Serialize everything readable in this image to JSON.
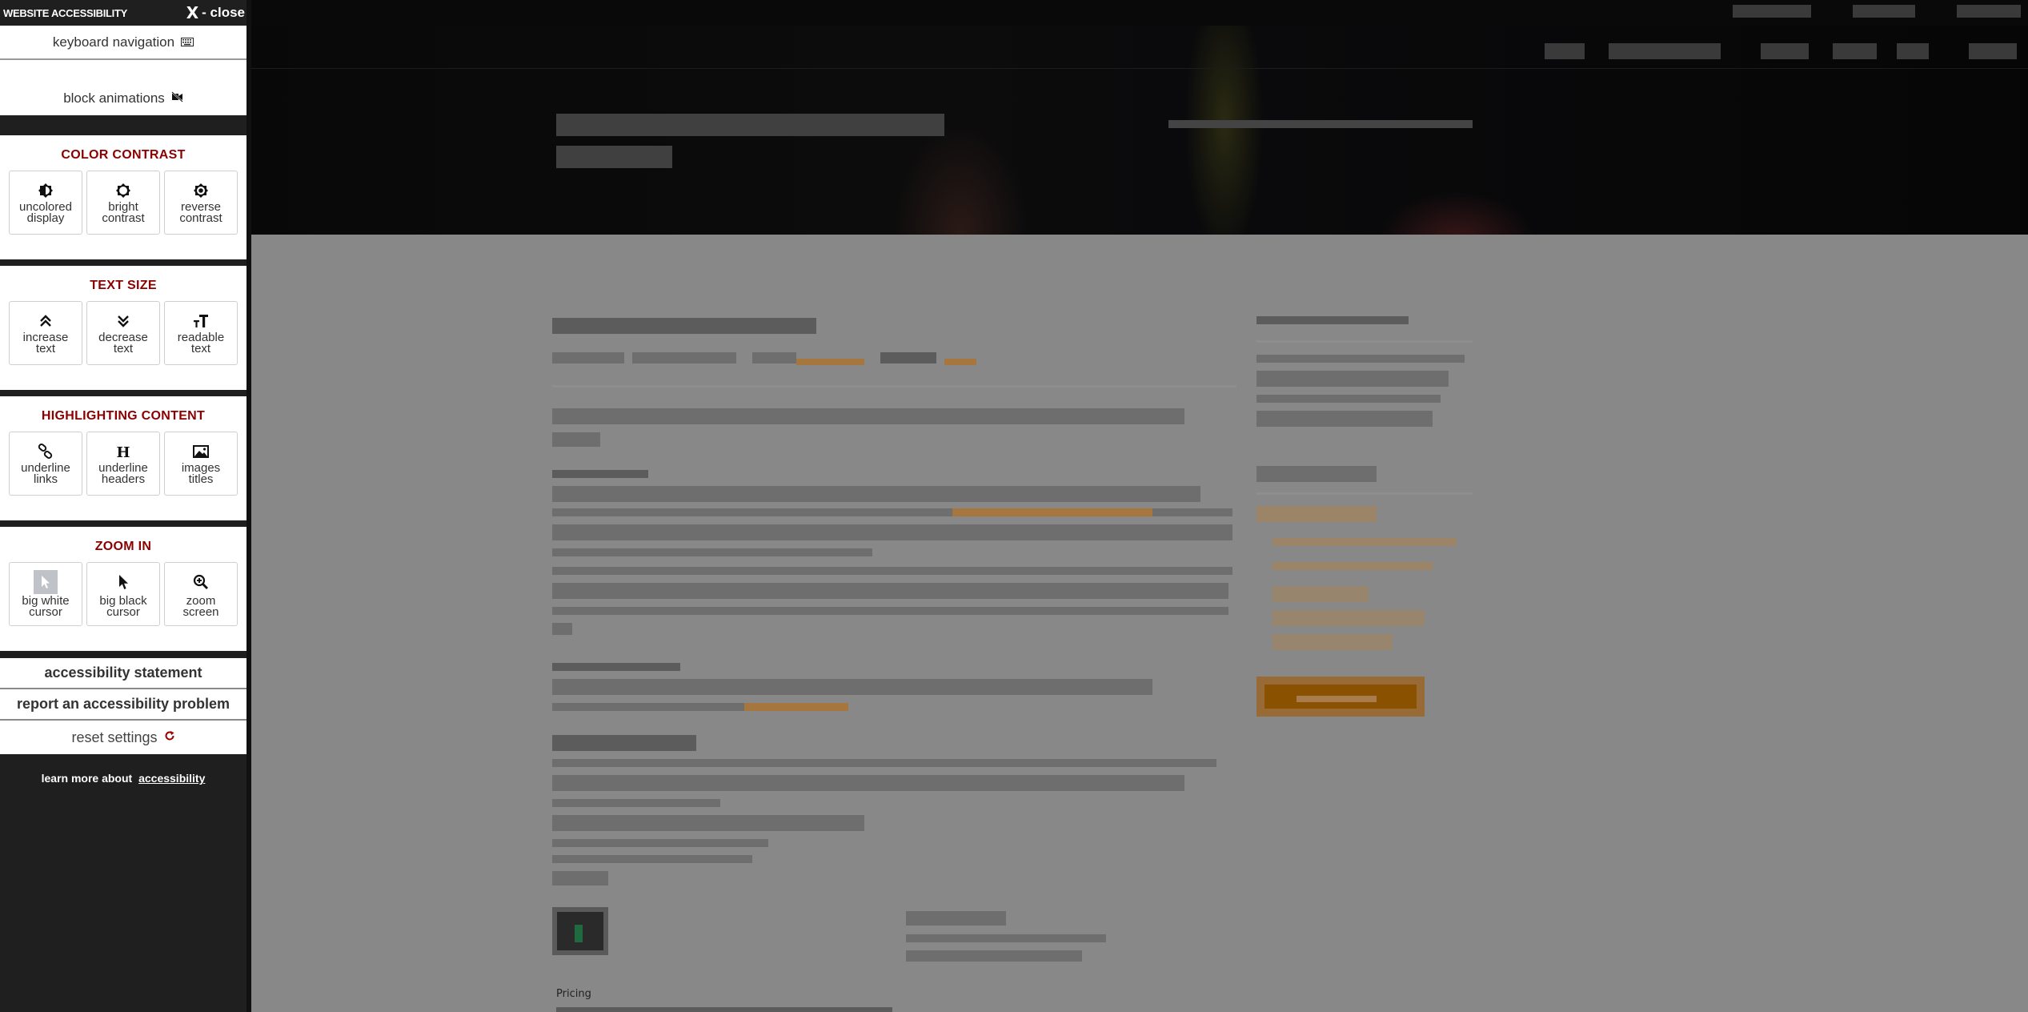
{
  "panel": {
    "title": "WEBSITE ACCESSIBILITY",
    "close_label": "X - close",
    "close_x": "X",
    "close_text": "- close",
    "keyboard_navigation": {
      "label": "keyboard navigation",
      "icon": "keyboard-icon"
    },
    "block_animations": {
      "label": "block animations",
      "icon": "video-off-icon"
    },
    "sections": [
      {
        "title": "COLOR CONTRAST",
        "options": [
          {
            "line1": "uncolored",
            "line2": "display",
            "icon": "half-contrast-icon"
          },
          {
            "line1": "bright",
            "line2": "contrast",
            "icon": "brightness-icon"
          },
          {
            "line1": "reverse",
            "line2": "contrast",
            "icon": "reverse-contrast-icon"
          }
        ]
      },
      {
        "title": "TEXT SIZE",
        "options": [
          {
            "line1": "increase",
            "line2": "text",
            "icon": "double-chevron-up-icon"
          },
          {
            "line1": "decrease",
            "line2": "text",
            "icon": "double-chevron-down-icon"
          },
          {
            "line1": "readable",
            "line2": "text",
            "icon": "text-size-icon"
          }
        ]
      },
      {
        "title": "HIGHLIGHTING CONTENT",
        "options": [
          {
            "line1": "underline",
            "line2": "links",
            "icon": "link-icon"
          },
          {
            "line1": "underline",
            "line2": "headers",
            "icon": "header-icon"
          },
          {
            "line1": "images",
            "line2": "titles",
            "icon": "image-icon"
          }
        ]
      },
      {
        "title": "ZOOM IN",
        "options": [
          {
            "line1": "big white",
            "line2": "cursor",
            "icon": "white-cursor-icon"
          },
          {
            "line1": "big black",
            "line2": "cursor",
            "icon": "black-cursor-icon"
          },
          {
            "line1": "zoom",
            "line2": "screen",
            "icon": "zoom-in-icon"
          }
        ]
      }
    ],
    "accessibility_statement": "accessibility statement",
    "report_problem": "report an accessibility problem",
    "reset_settings": "reset settings",
    "reset_icon": "refresh-icon",
    "learn_more_prefix": "learn more about",
    "learn_more_link": "accessibility"
  },
  "background_page": {
    "note_label": "Pricing",
    "colors": {
      "overlay_gray": "#888888",
      "header_dark": "#090909",
      "accent_orange": "#8a5200",
      "section_title_red": "#8b0000"
    }
  }
}
